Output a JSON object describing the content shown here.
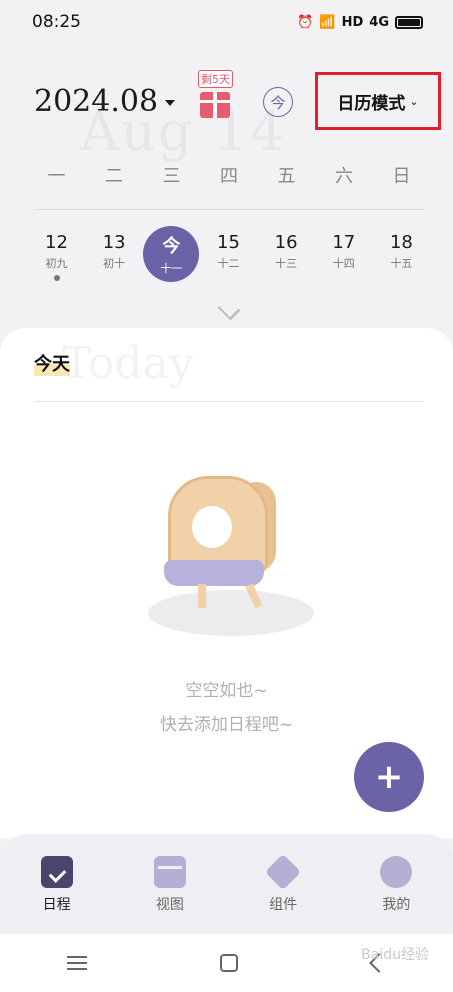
{
  "status_bar": {
    "time": "08:25",
    "icons": [
      "alarm-icon",
      "wifi-icon",
      "hd-icon",
      "4g-signal-icon",
      "battery-icon"
    ],
    "hd_label": "HD",
    "net_label": "4G"
  },
  "header": {
    "watermark": "Aug 14",
    "month": "2024.08",
    "gift_tag": "剩5天",
    "today_button": "今",
    "mode_label": "日历模式"
  },
  "weekdays": [
    "一",
    "二",
    "三",
    "四",
    "五",
    "六",
    "日"
  ],
  "days": [
    {
      "num": "12",
      "lunar": "初九",
      "dot": true,
      "selected": false
    },
    {
      "num": "13",
      "lunar": "初十",
      "dot": false,
      "selected": false
    },
    {
      "num": "今",
      "lunar": "十一",
      "dot": false,
      "selected": true
    },
    {
      "num": "15",
      "lunar": "十二",
      "dot": false,
      "selected": false
    },
    {
      "num": "16",
      "lunar": "十三",
      "dot": false,
      "selected": false
    },
    {
      "num": "17",
      "lunar": "十四",
      "dot": false,
      "selected": false
    },
    {
      "num": "18",
      "lunar": "十五",
      "dot": false,
      "selected": false
    }
  ],
  "main": {
    "watermark": "Today",
    "today_label": "今天",
    "empty_line1": "空空如也~",
    "empty_line2": "快去添加日程吧~"
  },
  "fab_label": "+",
  "bottom_nav": [
    {
      "label": "日程",
      "icon": "calendar-check-icon",
      "active": true
    },
    {
      "label": "视图",
      "icon": "layout-view-icon",
      "active": false
    },
    {
      "label": "组件",
      "icon": "cube-icon",
      "active": false
    },
    {
      "label": "我的",
      "icon": "profile-icon",
      "active": false
    }
  ],
  "colors": {
    "accent": "#6a63a8",
    "highlight_box": "#e0202c",
    "gift": "#e85b6e"
  },
  "watermark_brand": "Baidu经验"
}
